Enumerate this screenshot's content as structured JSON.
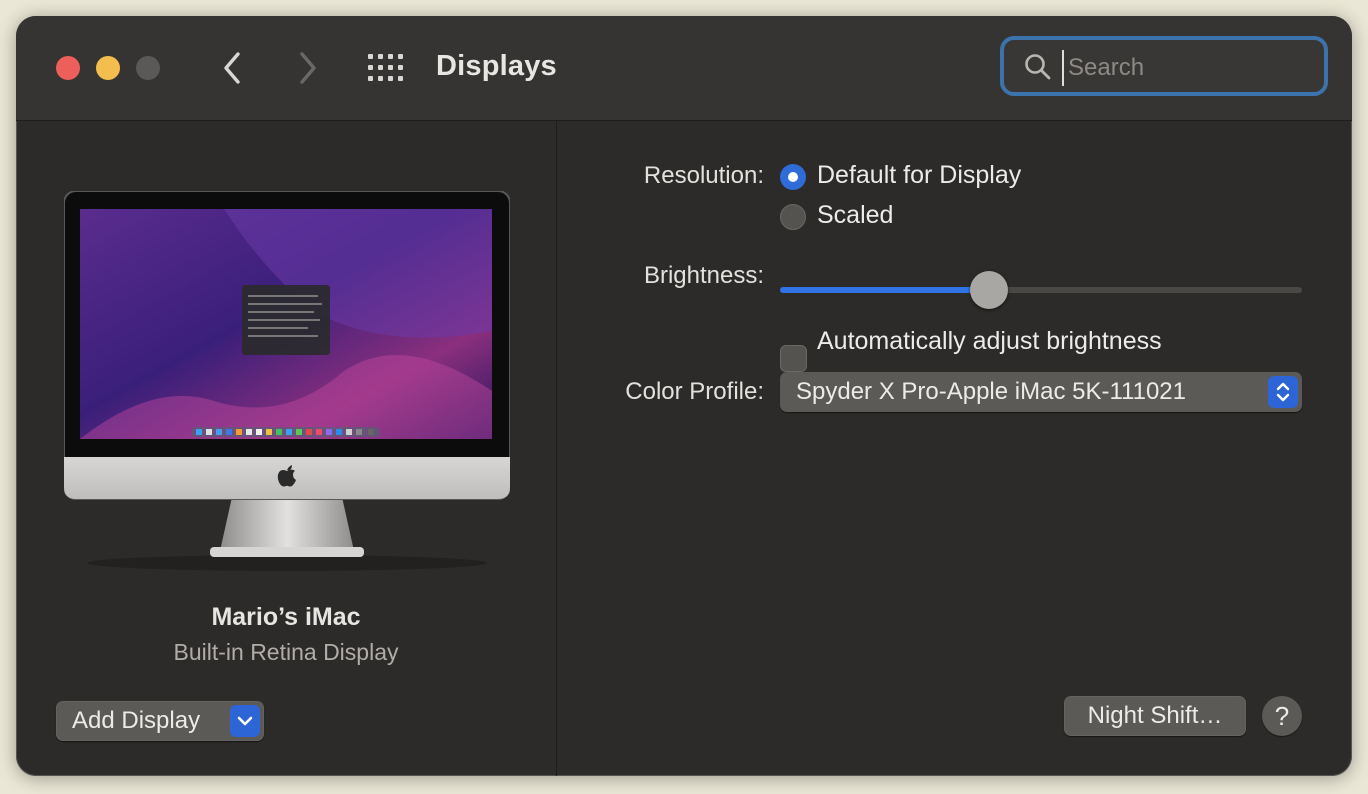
{
  "window": {
    "title": "Displays"
  },
  "search": {
    "placeholder": "Search",
    "value": ""
  },
  "sidebar": {
    "display_name": "Mario’s iMac",
    "display_type": "Built-in Retina Display",
    "add_display_label": "Add Display"
  },
  "settings": {
    "resolution_label": "Resolution:",
    "resolution_options": [
      "Default for Display",
      "Scaled"
    ],
    "resolution_selected": "Default for Display",
    "brightness_label": "Brightness:",
    "brightness_value": 0.4,
    "auto_brightness_label": "Automatically adjust brightness",
    "auto_brightness_checked": false,
    "color_profile_label": "Color Profile:",
    "color_profile_value": "Spyder X Pro-Apple iMac 5K-111021"
  },
  "footer": {
    "night_shift_label": "Night Shift…",
    "help_label": "?"
  },
  "colors": {
    "accent": "#2f6bd9",
    "close": "#ec5f5a",
    "minimize": "#f4be4f"
  },
  "icons": [
    "close-button",
    "minimize-button",
    "zoom-button",
    "back-chevron-icon",
    "forward-chevron-icon",
    "grid-icon",
    "search-icon",
    "apple-logo-icon",
    "chevron-down-icon",
    "up-down-chevron-icon"
  ]
}
